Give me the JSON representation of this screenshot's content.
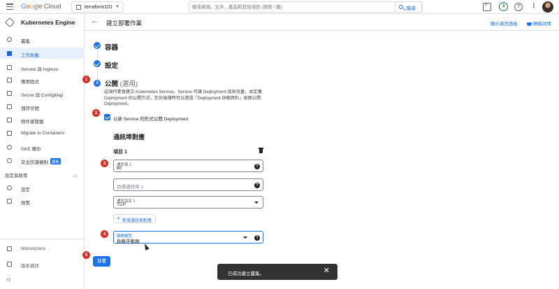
{
  "topbar": {
    "logo_google": "Google",
    "logo_cloud": "Cloud",
    "project": "terraform101",
    "search_placeholder": "搜尋資源、文件、產品和其他項目 (請按 / 鍵)",
    "search_button": "搜尋",
    "notifications_count": "3"
  },
  "sidebar": {
    "title": "Kubernetes Engine",
    "items": [
      {
        "label": "叢集",
        "icon": "cluster-icon"
      },
      {
        "label": "工作負載",
        "icon": "workloads-icon",
        "active": true
      },
      {
        "label": "Service 與 Ingress",
        "icon": "network-icon"
      },
      {
        "label": "應用程式",
        "icon": "apps-icon"
      },
      {
        "label": "Secret 與 ConfigMap",
        "icon": "config-icon"
      },
      {
        "label": "儲存空間",
        "icon": "storage-icon"
      },
      {
        "label": "物件瀏覽器",
        "icon": "object-browser-icon"
      },
      {
        "label": "Migrate to Containers",
        "icon": "migrate-icon"
      },
      {
        "label": "GKE 備份",
        "icon": "backup-icon"
      },
      {
        "label": "安全防護機制",
        "icon": "security-icon",
        "tag": "最新"
      }
    ],
    "section": "設定與政策",
    "section_items": [
      {
        "label": "設定",
        "icon": "settings-icon"
      },
      {
        "label": "政策",
        "icon": "policy-icon"
      }
    ],
    "bottom_items": [
      {
        "label": "Marketplace",
        "icon": "marketplace-icon"
      },
      {
        "label": "版本資訊",
        "icon": "release-notes-icon"
      }
    ],
    "collapse_glyph": "<|"
  },
  "header": {
    "title": "建立部署作業",
    "info_panel": "顯示資訊面板",
    "learn": "瞭解詳情"
  },
  "steps": [
    {
      "title": "容器",
      "status": "done"
    },
    {
      "title": "設定",
      "status": "done"
    },
    {
      "title": "公開",
      "optional": "(選用)",
      "number": "3",
      "status": "current"
    }
  ],
  "expose": {
    "description": "這項作業會建立 Kubernetes Service。Service 可讓 Deployment 接收流量，並定義 Deployment 的公開方式。您日後隨時可以透過「Deployment 詳細資料」頁面公開 Deployment。",
    "checkbox_label": "以新 Service 的形式公開 Deployment",
    "checkbox_checked": true,
    "section_title": "通訊埠對應",
    "item_title": "項目 1",
    "port_label": "通訊埠 1",
    "port_value": "80",
    "target_port_placeholder": "目標通訊埠 1",
    "protocol_label": "通訊協定 1",
    "protocol_value": "TCP",
    "add_button": "新增通訊埠對應",
    "service_type_label": "服務類型",
    "service_type_value": "負載平衡器",
    "deploy_button": "部署"
  },
  "markers": [
    "1",
    "2",
    "3",
    "4",
    "5"
  ],
  "toast": {
    "message": "已成功建立叢集。",
    "close": "✕"
  },
  "colors": {
    "primary": "#1a73e8",
    "marker": "#d93025",
    "toast_bg": "#323232"
  }
}
